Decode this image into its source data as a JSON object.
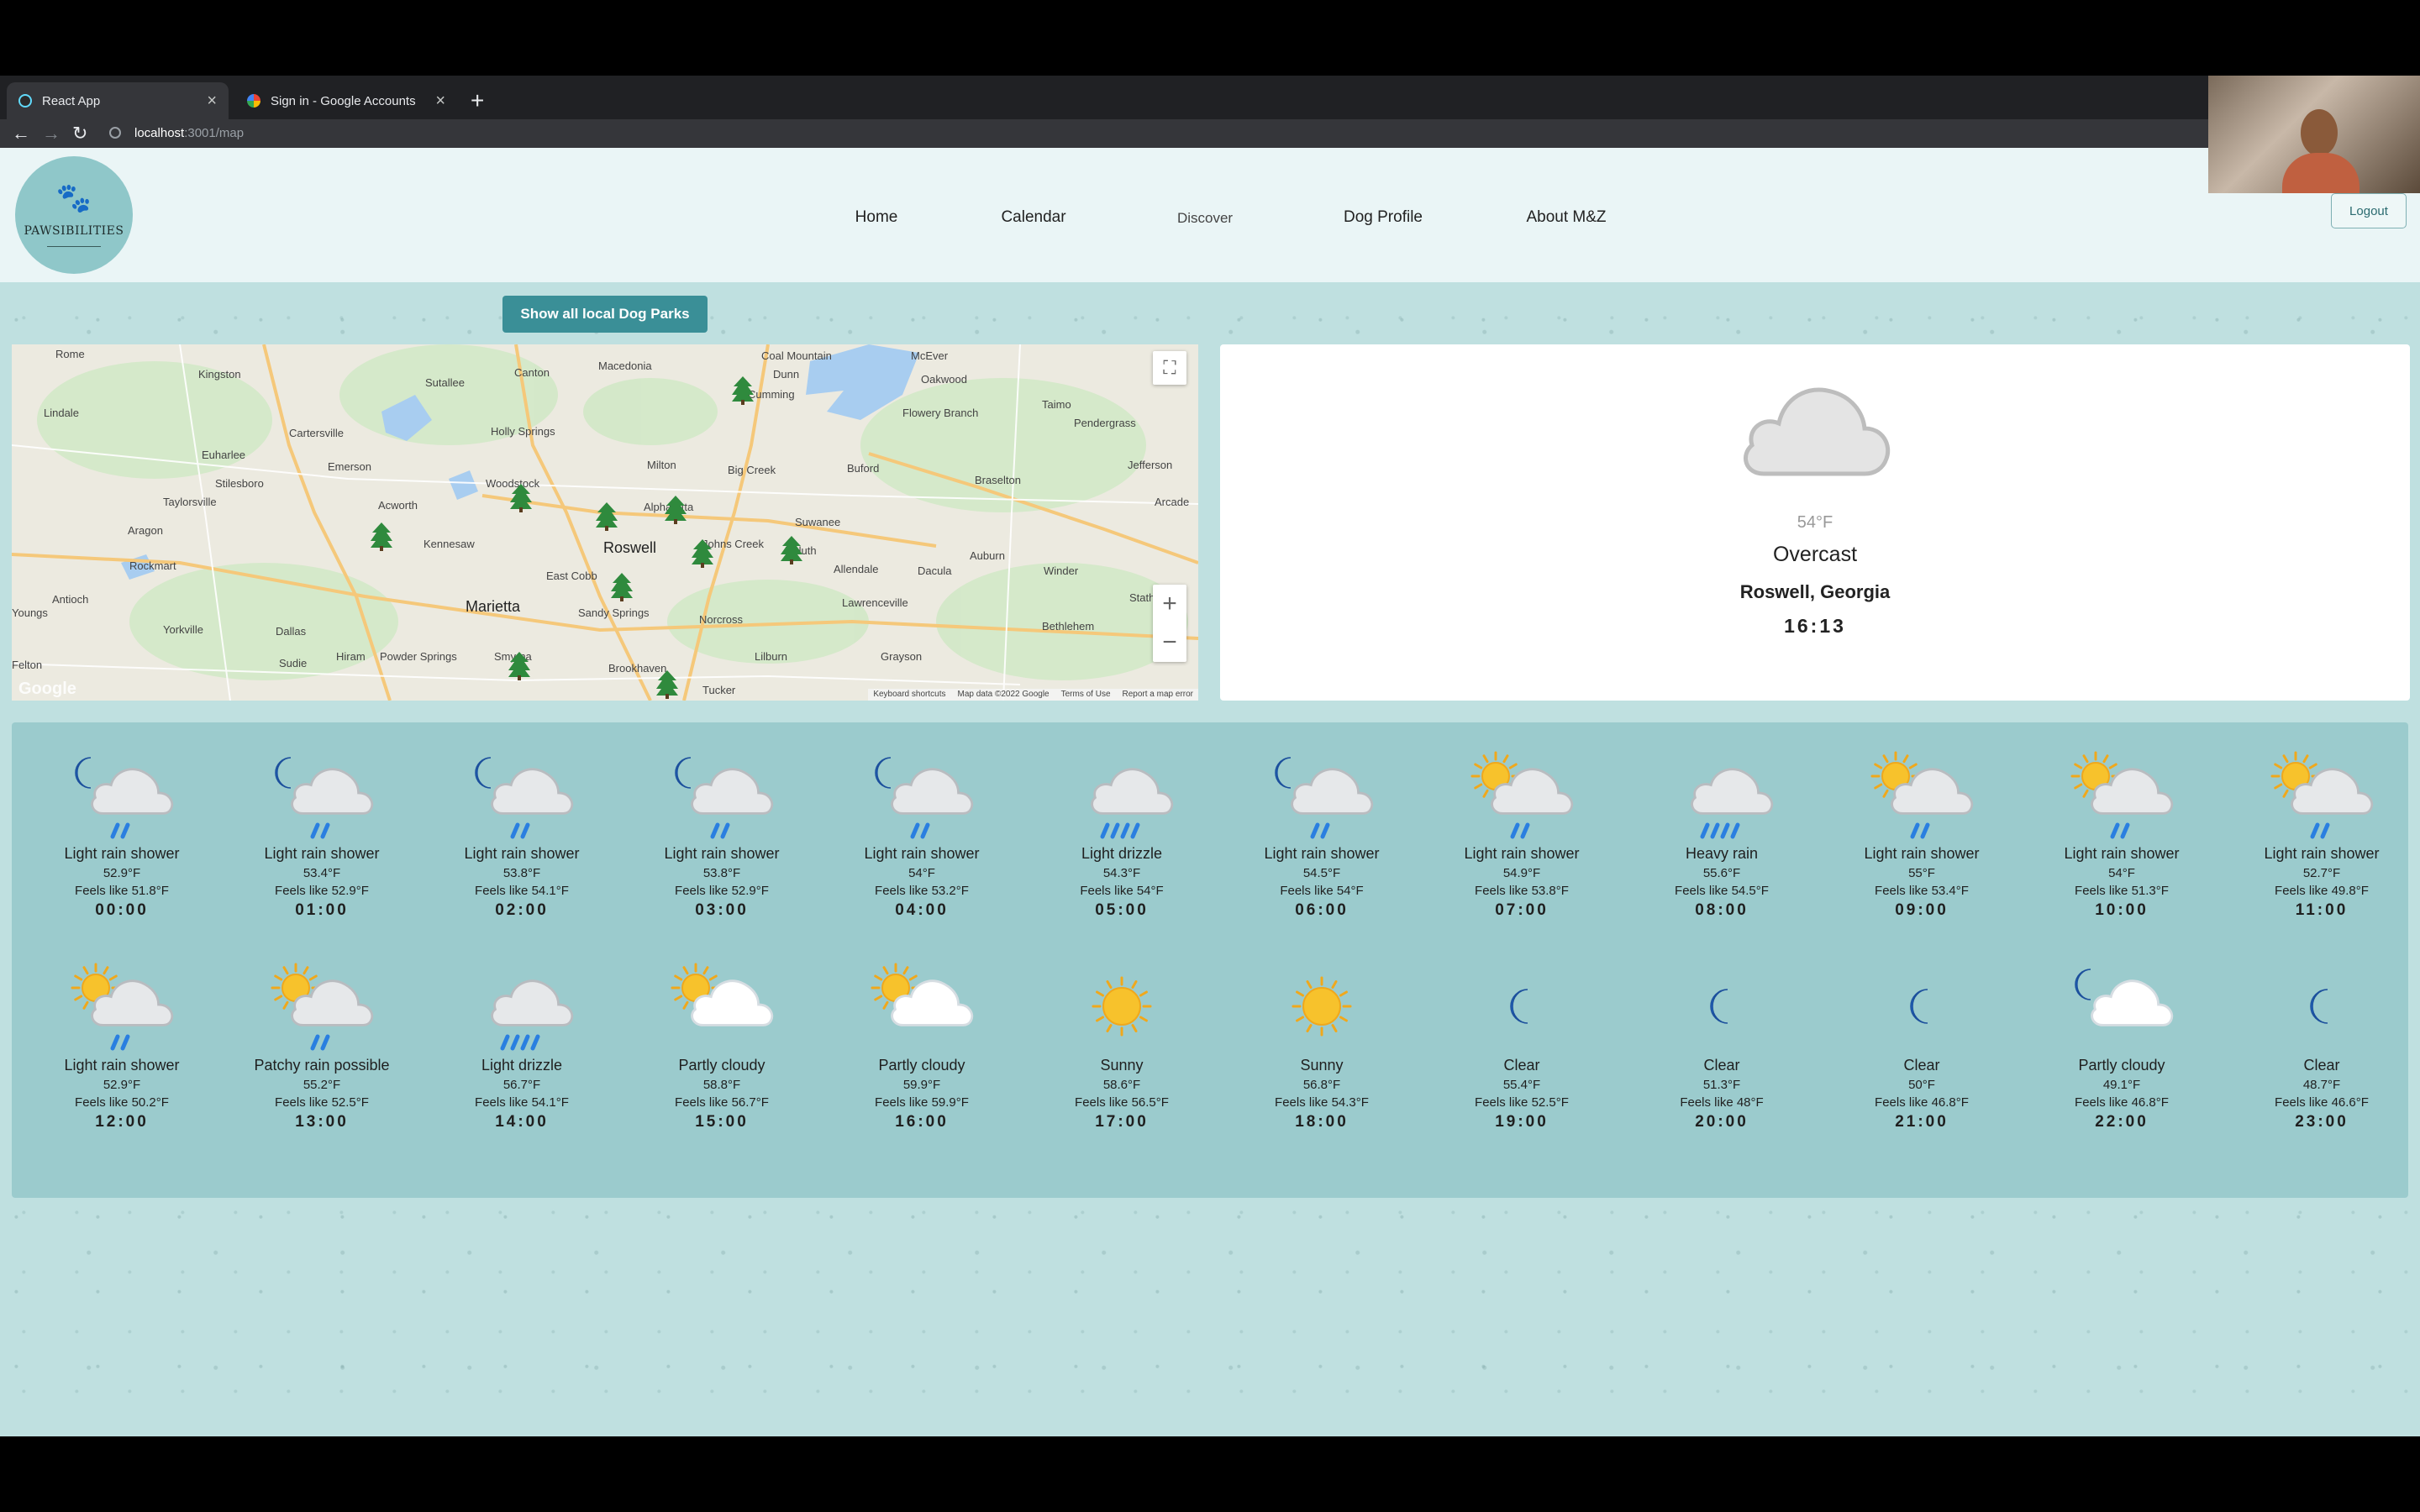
{
  "browser": {
    "tabs": [
      {
        "label": "React App",
        "active": true,
        "favicon_color": "#61dafb"
      },
      {
        "label": "Sign in - Google Accounts",
        "active": false,
        "favicon_color": "#ffffff"
      }
    ],
    "new_tab": "+",
    "close": "×",
    "url_host": "localhost",
    "url_path": ":3001/map"
  },
  "header": {
    "logo_text": "PAWSIBILITIES",
    "nav": [
      {
        "label": "Home"
      },
      {
        "label": "Calendar"
      },
      {
        "label": "Discover"
      },
      {
        "label": "Dog Profile"
      },
      {
        "label": "About M&Z"
      }
    ],
    "logout_label": "Logout"
  },
  "actions": {
    "show_parks_label": "Show all local Dog Parks"
  },
  "map": {
    "towns": [
      "Rome",
      "Kingston",
      "Sutallee",
      "Canton",
      "Macedonia",
      "Dunn",
      "Coal Mountain",
      "McEver",
      "Oakwood",
      "Lindale",
      "Cartersville",
      "Holly Springs",
      "Cumming",
      "Flowery Branch",
      "Taimo",
      "Pendergrass",
      "Euharlee",
      "Emerson",
      "Milton",
      "Big Creek",
      "Buford",
      "Braselton",
      "Jefferson",
      "Stilesboro",
      "Woodstock",
      "Taylorsville",
      "Acworth",
      "Alpharetta",
      "Suwanee",
      "Arcade",
      "Aragon",
      "Kennesaw",
      "Roswell",
      "Johns Creek",
      "Duluth",
      "Auburn",
      "Rockmart",
      "East Cobb",
      "Allendale",
      "Dacula",
      "Winder",
      "Antioch",
      "Marietta",
      "Sandy Springs",
      "Norcross",
      "Lawrenceville",
      "Statham",
      "Youngs",
      "Yorkville",
      "Dallas",
      "Bethlehem",
      "Hiram",
      "Smyrna",
      "Lilburn",
      "Grayson",
      "Felton",
      "Sudie",
      "Powder Springs",
      "Brookhaven",
      "Tucker"
    ],
    "footer": [
      "Keyboard shortcuts",
      "Map data ©2022 Google",
      "Terms of Use",
      "Report a map error"
    ],
    "google_logo": "Google",
    "zoom_in": "+",
    "zoom_out": "−",
    "fullscreen": "⛶"
  },
  "current": {
    "temp": "54°F",
    "condition": "Overcast",
    "location": "Roswell, Georgia",
    "time": "16:13"
  },
  "forecast": [
    {
      "cond": "Light rain shower",
      "temp": "52.9°F",
      "feels": "Feels like 51.8°F",
      "time": "00:00",
      "icon": "moon-cloud-rain"
    },
    {
      "cond": "Light rain shower",
      "temp": "53.4°F",
      "feels": "Feels like 52.9°F",
      "time": "01:00",
      "icon": "moon-cloud-rain"
    },
    {
      "cond": "Light rain shower",
      "temp": "53.8°F",
      "feels": "Feels like 54.1°F",
      "time": "02:00",
      "icon": "moon-cloud-rain"
    },
    {
      "cond": "Light rain shower",
      "temp": "53.8°F",
      "feels": "Feels like 52.9°F",
      "time": "03:00",
      "icon": "moon-cloud-rain"
    },
    {
      "cond": "Light rain shower",
      "temp": "54°F",
      "feels": "Feels like 53.2°F",
      "time": "04:00",
      "icon": "moon-cloud-rain"
    },
    {
      "cond": "Light drizzle",
      "temp": "54.3°F",
      "feels": "Feels like 54°F",
      "time": "05:00",
      "icon": "cloud-drizzle"
    },
    {
      "cond": "Light rain shower",
      "temp": "54.5°F",
      "feels": "Feels like 54°F",
      "time": "06:00",
      "icon": "moon-cloud-rain"
    },
    {
      "cond": "Light rain shower",
      "temp": "54.9°F",
      "feels": "Feels like 53.8°F",
      "time": "07:00",
      "icon": "sun-cloud-rain"
    },
    {
      "cond": "Heavy rain",
      "temp": "55.6°F",
      "feels": "Feels like 54.5°F",
      "time": "08:00",
      "icon": "cloud-heavy-rain"
    },
    {
      "cond": "Light rain shower",
      "temp": "55°F",
      "feels": "Feels like 53.4°F",
      "time": "09:00",
      "icon": "sun-cloud-rain"
    },
    {
      "cond": "Light rain shower",
      "temp": "54°F",
      "feels": "Feels like 51.3°F",
      "time": "10:00",
      "icon": "sun-cloud-rain"
    },
    {
      "cond": "Light rain shower",
      "temp": "52.7°F",
      "feels": "Feels like 49.8°F",
      "time": "11:00",
      "icon": "sun-cloud-rain"
    },
    {
      "cond": "Light rain shower",
      "temp": "52.9°F",
      "feels": "Feels like 50.2°F",
      "time": "12:00",
      "icon": "sun-cloud-rain"
    },
    {
      "cond": "Patchy rain possible",
      "temp": "55.2°F",
      "feels": "Feels like 52.5°F",
      "time": "13:00",
      "icon": "sun-cloud-rain"
    },
    {
      "cond": "Light drizzle",
      "temp": "56.7°F",
      "feels": "Feels like 54.1°F",
      "time": "14:00",
      "icon": "cloud-drizzle"
    },
    {
      "cond": "Partly cloudy",
      "temp": "58.8°F",
      "feels": "Feels like 56.7°F",
      "time": "15:00",
      "icon": "sun-cloud"
    },
    {
      "cond": "Partly cloudy",
      "temp": "59.9°F",
      "feels": "Feels like 59.9°F",
      "time": "16:00",
      "icon": "sun-cloud"
    },
    {
      "cond": "Sunny",
      "temp": "58.6°F",
      "feels": "Feels like 56.5°F",
      "time": "17:00",
      "icon": "sun"
    },
    {
      "cond": "Sunny",
      "temp": "56.8°F",
      "feels": "Feels like 54.3°F",
      "time": "18:00",
      "icon": "sun"
    },
    {
      "cond": "Clear",
      "temp": "55.4°F",
      "feels": "Feels like 52.5°F",
      "time": "19:00",
      "icon": "moon"
    },
    {
      "cond": "Clear",
      "temp": "51.3°F",
      "feels": "Feels like 48°F",
      "time": "20:00",
      "icon": "moon"
    },
    {
      "cond": "Clear",
      "temp": "50°F",
      "feels": "Feels like 46.8°F",
      "time": "21:00",
      "icon": "moon"
    },
    {
      "cond": "Partly cloudy",
      "temp": "49.1°F",
      "feels": "Feels like 46.8°F",
      "time": "22:00",
      "icon": "moon-cloud"
    },
    {
      "cond": "Clear",
      "temp": "48.7°F",
      "feels": "Feels like 46.6°F",
      "time": "23:00",
      "icon": "moon"
    }
  ],
  "colors": {
    "accent": "#3a8f97",
    "page_bg": "#bfe0e0",
    "forecast_bg": "#9bcbcd",
    "header_bg": "#eaf5f6",
    "sun": "#f7c22c",
    "moon": "#2a7fe0",
    "rain": "#2a7fe0",
    "cloud": "#e9eef1"
  }
}
